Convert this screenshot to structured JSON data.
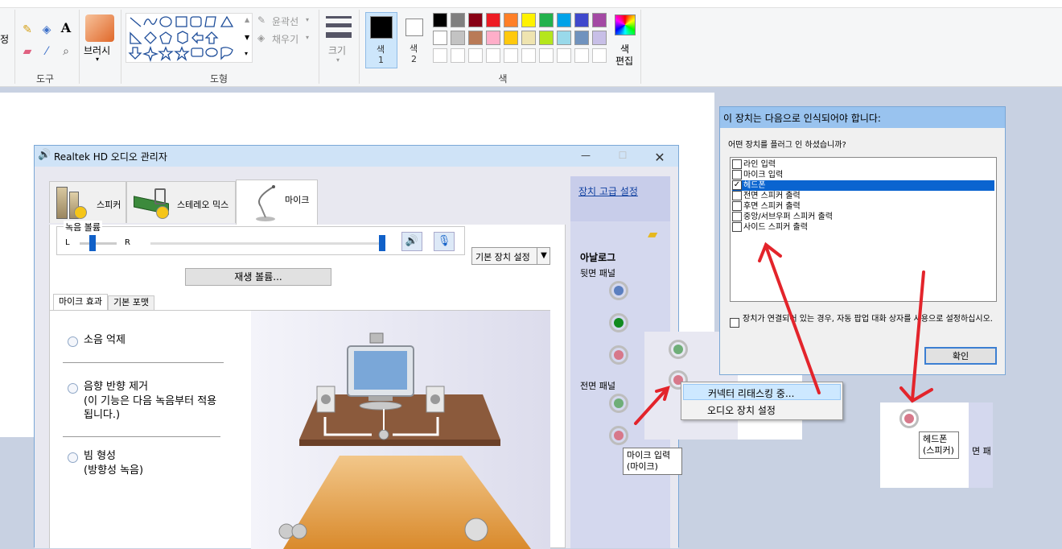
{
  "ribbon": {
    "left_edge_label": "정",
    "tools_group": {
      "label": "도구"
    },
    "brush": {
      "label": "브러시"
    },
    "shapes_group": {
      "label": "도형",
      "outline": "윤곽선",
      "fill": "채우기"
    },
    "size": {
      "label": "크기"
    },
    "color1": {
      "line1": "색",
      "line2": "1"
    },
    "color2": {
      "line1": "색",
      "line2": "2"
    },
    "colors_group": {
      "label": "색"
    },
    "edit_colors": {
      "line1": "색",
      "line2": "편집"
    },
    "palette_row1": [
      "#000000",
      "#7f7f7f",
      "#880015",
      "#ed1c24",
      "#ff7f27",
      "#fff200",
      "#22b14c",
      "#00a2e8",
      "#3f48cc",
      "#a349a4"
    ],
    "palette_row2": [
      "#ffffff",
      "#c3c3c3",
      "#b97a57",
      "#ffaec9",
      "#ffc90e",
      "#efe4b0",
      "#b5e61d",
      "#99d9ea",
      "#7092be",
      "#c8bfe7"
    ]
  },
  "realtek": {
    "title": "Realtek HD 오디오 관리자",
    "tabs": [
      {
        "label": "스피커"
      },
      {
        "label": "스테레오 믹스"
      },
      {
        "label": "마이크"
      }
    ],
    "record_volume": {
      "label": "녹음 볼륨",
      "left": "L",
      "right": "R",
      "balance": 0.35,
      "level": 1.0
    },
    "default_device": "기본 장치 설정",
    "playback_volume": "재생 볼륨...",
    "subtabs": [
      {
        "label": "마이크 효과"
      },
      {
        "label": "기본 포맷"
      }
    ],
    "effects": [
      {
        "label": "소음 억제"
      },
      {
        "label": "음향 반향 제거",
        "desc": "(이 기능은 다음 녹음부터 적용됩니다.)"
      },
      {
        "label": "빔 형성",
        "desc": "(방향성 녹음)"
      }
    ],
    "advanced_link": "장치 고급 설정",
    "analog_title": "아날로그",
    "rear_panel": "뒷면 패널",
    "front_panel": "전면 패널",
    "jack_colors": {
      "blue": "#5b7fc0",
      "green": "#118a1f",
      "pink": "#d7788a",
      "green_light": "#6fae78"
    }
  },
  "context_menu": {
    "items": [
      {
        "label": "커넥터 리태스킹 중..."
      },
      {
        "label": "오디오 장치 설정"
      }
    ]
  },
  "tooltip_mic": {
    "line1": "마이크 입력",
    "line2": "(마이크)"
  },
  "tooltip_headphone": {
    "line1": "헤드폰",
    "line2": "(스피커)"
  },
  "side_panel_fragment": "면 패",
  "dialog": {
    "title": "이 장치는 다음으로 인식되어야 합니다:",
    "question": "어떤 장치를 플러그 인 하셨습니까?",
    "options": [
      {
        "label": "라인 입력",
        "checked": false
      },
      {
        "label": "마이크 입력",
        "checked": false
      },
      {
        "label": "헤드폰",
        "checked": true
      },
      {
        "label": "전면 스피커 출력",
        "checked": false
      },
      {
        "label": "후면 스피커 출력",
        "checked": false
      },
      {
        "label": "중앙/서브우퍼 스피커 출력",
        "checked": false
      },
      {
        "label": "사이드 스피커 출력",
        "checked": false
      }
    ],
    "popup_checkbox": "장치가 연결되어 있는 경우, 자동 팝업 대화 상자를 사용으로 설정하십시오.",
    "ok": "확인"
  },
  "accent": "#e3242b"
}
